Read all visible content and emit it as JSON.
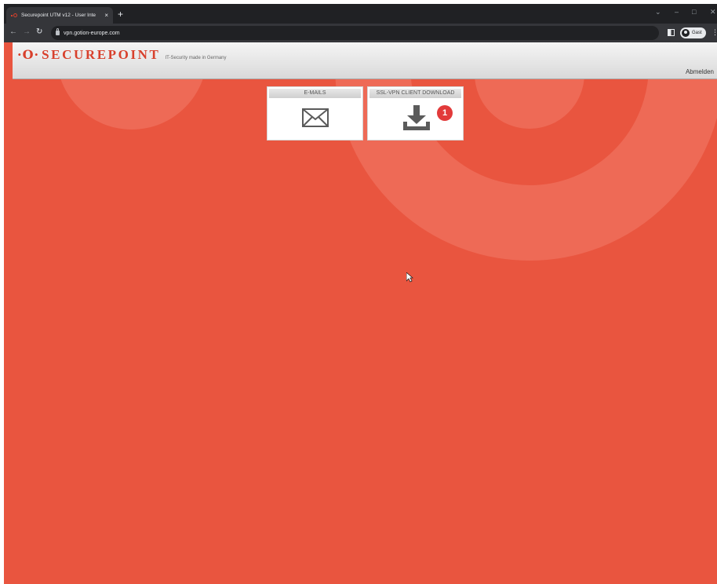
{
  "browser": {
    "tab_title": "Securepoint UTM v12 - User Inte",
    "tab_close": "×",
    "new_tab": "+",
    "url": "vpn.gotion-europe.com",
    "profile_label": "Gast"
  },
  "header": {
    "logo_mark": "·O·",
    "logo_text": "SECUREPOINT",
    "tagline": "IT-Security made in Germany",
    "logout_label": "Abmelden"
  },
  "tiles": [
    {
      "label": "E-MAILS",
      "icon": "envelope-icon"
    },
    {
      "label": "SSL-VPN CLIENT DOWNLOAD",
      "icon": "download-icon",
      "badge": "1"
    }
  ],
  "colors": {
    "background": "#e9553f",
    "accent": "#d8402c",
    "badge": "#e23a3a",
    "titlebar": "#202124",
    "toolbar": "#35363a"
  }
}
